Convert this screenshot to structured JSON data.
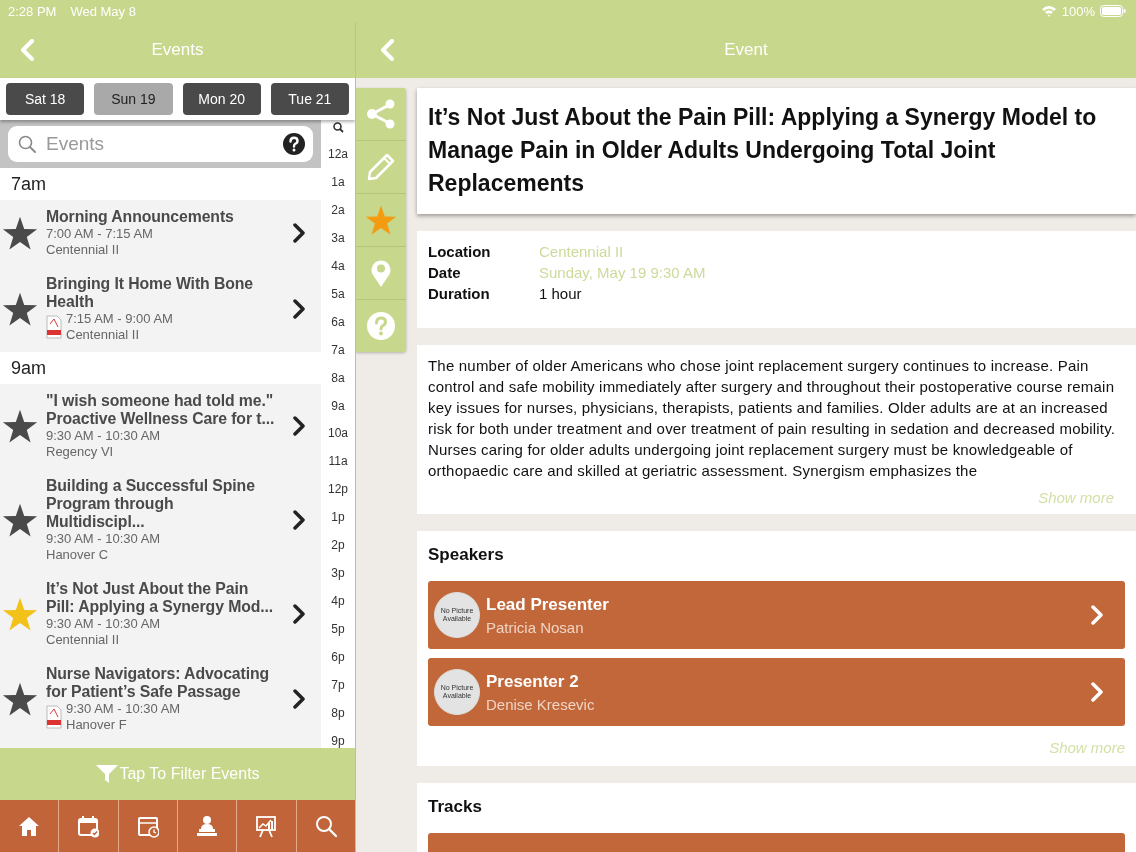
{
  "status_bar": {
    "time": "2:28 PM",
    "date": "Wed May 8",
    "battery": "100%"
  },
  "events_panel": {
    "title": "Events",
    "days": [
      {
        "label": "Sat 18",
        "selected": false
      },
      {
        "label": "Sun 19",
        "selected": true
      },
      {
        "label": "Mon 20",
        "selected": false
      },
      {
        "label": "Tue 21",
        "selected": false
      }
    ],
    "search": {
      "placeholder": "Events"
    },
    "time_index": [
      "12a",
      "1a",
      "2a",
      "3a",
      "4a",
      "5a",
      "6a",
      "7a",
      "8a",
      "9a",
      "10a",
      "11a",
      "12p",
      "1p",
      "2p",
      "3p",
      "4p",
      "5p",
      "6p",
      "7p",
      "8p",
      "9p"
    ],
    "sections": [
      {
        "heading": "7am",
        "events": [
          {
            "title": "Morning Announcements",
            "time": "7:00 AM - 7:15 AM",
            "room": "Centennial II",
            "starred": false,
            "has_pdf": false
          },
          {
            "title": "Bringing It Home With Bone Health",
            "time": "7:15 AM - 9:00 AM",
            "room": "Centennial II",
            "starred": false,
            "has_pdf": true
          }
        ]
      },
      {
        "heading": "9am",
        "events": [
          {
            "title": "\"I wish someone had told me.\" Proactive Wellness Care for t...",
            "time": "9:30 AM - 10:30 AM",
            "room": "Regency VI",
            "starred": false,
            "has_pdf": false
          },
          {
            "title": "Building a Successful Spine Program through Multidiscipl...",
            "time": "9:30 AM - 10:30 AM",
            "room": "Hanover C",
            "starred": false,
            "has_pdf": false
          },
          {
            "title": "It’s Not Just About the Pain Pill: Applying a Synergy Mod...",
            "time": "9:30 AM - 10:30 AM",
            "room": "Centennial II",
            "starred": true,
            "has_pdf": false
          },
          {
            "title": "Nurse Navigators: Advocating for Patient’s Safe Passage",
            "time": "9:30 AM - 10:30 AM",
            "room": "Hanover F",
            "starred": false,
            "has_pdf": true
          }
        ]
      }
    ],
    "filter": {
      "label": "Tap To Filter Events"
    }
  },
  "event_panel": {
    "title": "Event",
    "starred": true,
    "event_title": "It’s Not Just About the Pain Pill: Applying a Synergy Model to Manage Pain in Older Adults Undergoing Total Joint Replacements",
    "details": [
      {
        "label": "Location",
        "value": "Centennial II",
        "kind": "link"
      },
      {
        "label": "Date",
        "value": "Sunday, May 19 9:30 AM",
        "kind": "link"
      },
      {
        "label": "Duration",
        "value": "1 hour",
        "kind": "plain"
      }
    ],
    "description": "The number of older Americans who chose joint replacement surgery continues to increase. Pain control and safe mobility immediately after surgery and throughout their postoperative course remain key issues for nurses, physicians, therapists, patients and families. Older adults are at an increased risk for both under treatment and over treatment of pain resulting in sedation and decreased mobility. Nurses caring for older adults undergoing joint replacement surgery must be knowledgeable of orthopaedic care and skilled at geriatric assessment. Synergism emphasizes the",
    "description_more": "Show more",
    "speakers": {
      "heading": "Speakers",
      "items": [
        {
          "role": "Lead Presenter",
          "name": "Patricia Nosan",
          "avatar_label": "No Picture Available"
        },
        {
          "role": "Presenter 2",
          "name": "Denise Kresevic",
          "avatar_label": "No Picture Available"
        }
      ],
      "more": "Show more"
    },
    "tracks": {
      "heading": "Tracks"
    }
  }
}
